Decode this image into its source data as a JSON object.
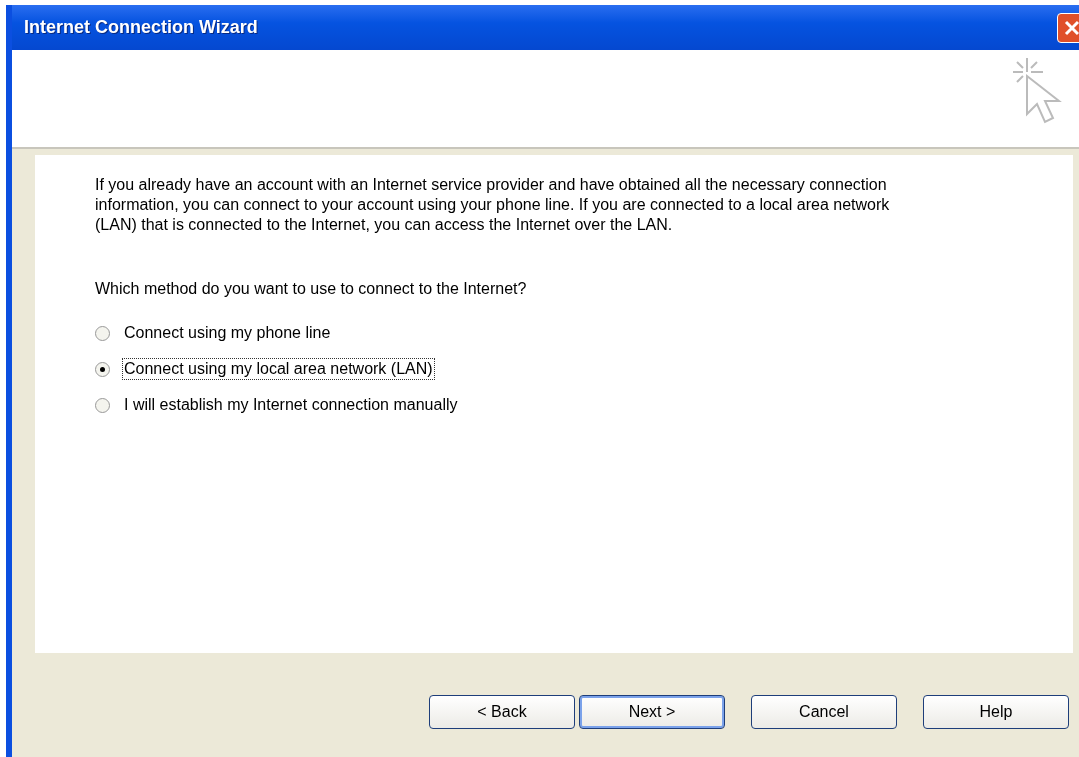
{
  "window": {
    "title": "Internet Connection Wizard"
  },
  "intro": "If you already have an account with an Internet service provider and have obtained all the necessary connection information, you can connect to your account using your phone line. If you are connected to a local area network (LAN) that is connected to the Internet, you can access the Internet over the LAN.",
  "question": "Which method do you want to use to connect to the Internet?",
  "options": [
    {
      "label": "Connect using my phone line",
      "selected": false,
      "focused": false
    },
    {
      "label": "Connect using my local area network (LAN)",
      "selected": true,
      "focused": true
    },
    {
      "label": "I will establish my Internet connection manually",
      "selected": false,
      "focused": false
    }
  ],
  "buttons": [
    {
      "label": "< Back",
      "default": false
    },
    {
      "label": "Next >",
      "default": true
    },
    {
      "label": "Cancel",
      "default": false
    },
    {
      "label": "Help",
      "default": false
    }
  ]
}
